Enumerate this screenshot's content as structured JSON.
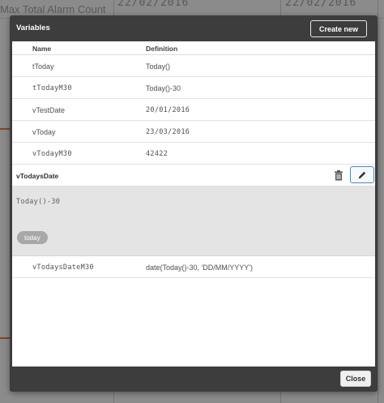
{
  "background": {
    "chart_title": "Max Total Alarm Count",
    "date_1": "22/02/2016",
    "date_2": "22/02/2016"
  },
  "dialog": {
    "title": "Variables",
    "create_button": "Create new",
    "columns": {
      "name": "Name",
      "definition": "Definition"
    },
    "rows": [
      {
        "name": "tToday",
        "definition": "Today()"
      },
      {
        "name": "tTodayM30",
        "definition": "Today()-30"
      },
      {
        "name": "vTestDate",
        "definition": "20/01/2016"
      },
      {
        "name": "vToday",
        "definition": "23/03/2016"
      },
      {
        "name": "vTodayM30",
        "definition": "42422"
      }
    ],
    "expanded": {
      "name": "vTodaysDate",
      "definition": "Today()-30",
      "tag": "today",
      "delete_icon": "trash-icon",
      "edit_icon": "pencil-icon"
    },
    "rows_after": [
      {
        "name": "vTodaysDateM30",
        "definition": "date(Today()-30, 'DD/MM/YYYY')"
      }
    ],
    "close_button": "Close"
  },
  "colors": {
    "modal_bg": "#3d3d3d",
    "edit_border": "#4a86c8",
    "expanded_bg": "#e4e4e4",
    "tag_bg": "#a8a8a8"
  }
}
